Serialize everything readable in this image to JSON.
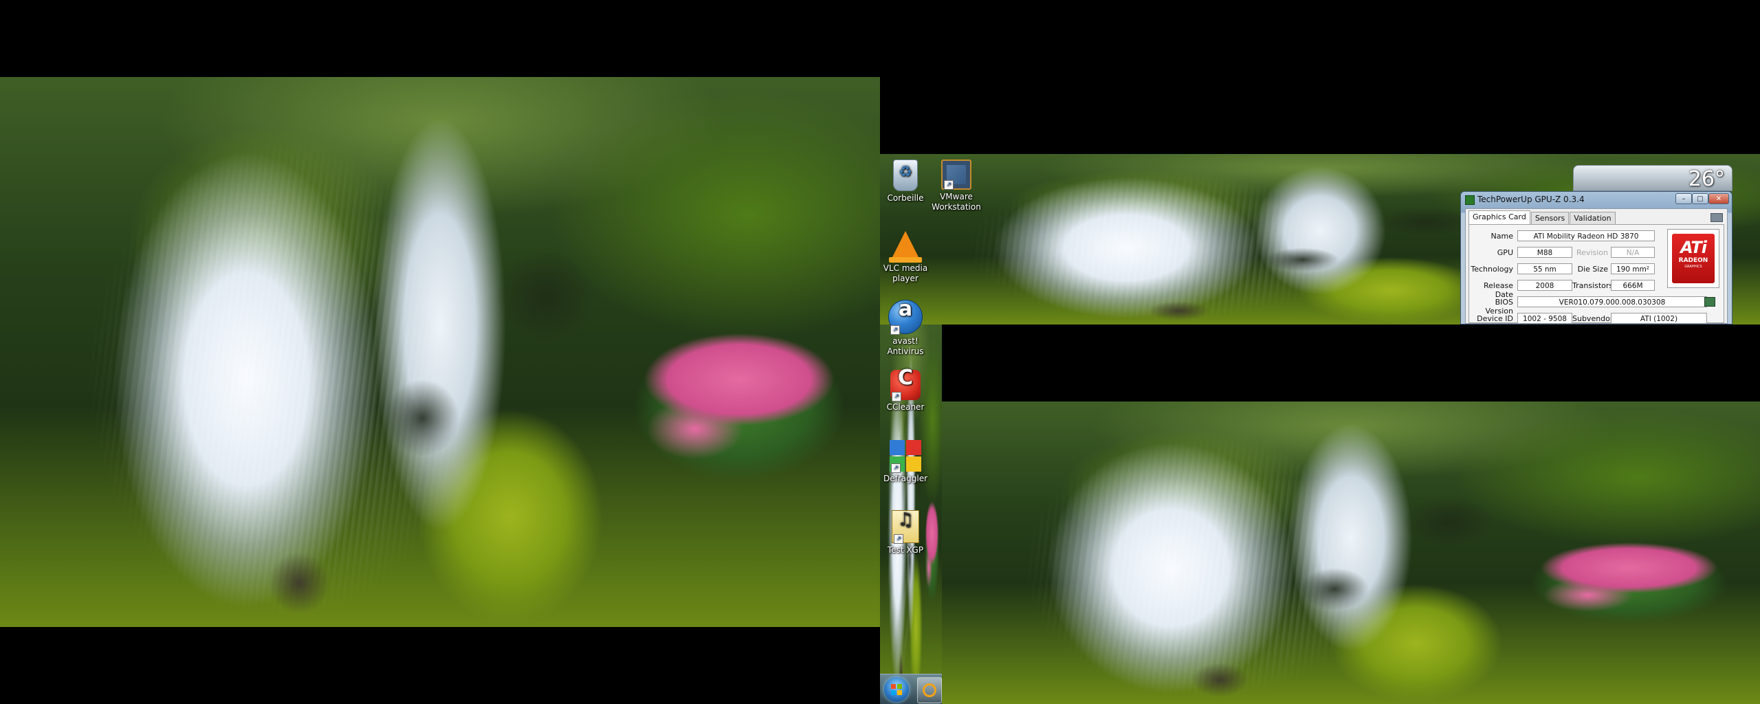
{
  "desktop": {
    "icons": [
      {
        "id": "recycle-bin",
        "label": "Corbeille",
        "icon": "recycle-bin-icon",
        "shortcut": false
      },
      {
        "id": "vmware",
        "label": "VMware\nWorkstation",
        "icon": "vmware-icon",
        "shortcut": true
      },
      {
        "id": "vlc",
        "label": "VLC media\nplayer",
        "icon": "vlc-icon",
        "shortcut": true
      },
      {
        "id": "avast",
        "label": "avast!\nAntivirus",
        "icon": "avast-icon",
        "shortcut": true
      },
      {
        "id": "ccleaner",
        "label": "CCleaner",
        "icon": "ccleaner-icon",
        "shortcut": true
      },
      {
        "id": "defraggler",
        "label": "Defraggler",
        "icon": "defraggler-icon",
        "shortcut": true
      },
      {
        "id": "test-xgp",
        "label": "Test XGP",
        "icon": "music-file-icon",
        "shortcut": true
      }
    ]
  },
  "weather": {
    "temperature": "26°"
  },
  "gpuz": {
    "title": "TechPowerUp GPU-Z 0.3.4",
    "buttons": {
      "minimize": "–",
      "maximize": "□",
      "close": "✕"
    },
    "tabs": [
      {
        "label": "Graphics Card",
        "active": true
      },
      {
        "label": "Sensors",
        "active": false
      },
      {
        "label": "Validation",
        "active": false
      }
    ],
    "fields": {
      "name_label": "Name",
      "name_value": "ATI Mobility Radeon HD 3870",
      "gpu_label": "GPU",
      "gpu_value": "M88",
      "revision_label": "Revision",
      "revision_value": "N/A",
      "technology_label": "Technology",
      "technology_value": "55 nm",
      "die_size_label": "Die Size",
      "die_size_value": "190 mm²",
      "release_date_label": "Release Date",
      "release_date_value": "2008",
      "transistors_label": "Transistors",
      "transistors_value": "666M",
      "bios_label": "BIOS Version",
      "bios_value": "VER010.079.000.008.030308",
      "device_id_label": "Device ID",
      "device_id_value": "1002 - 9508",
      "subvendor_label": "Subvendor",
      "subvendor_value": "ATI (1002)"
    },
    "logo": {
      "brand": "ATi",
      "line1": "RADEON",
      "line2": "GRAPHICS"
    }
  },
  "taskbar": {
    "start_icon": "windows-start-orb-icon",
    "pinned_icon": "browser-icon"
  }
}
